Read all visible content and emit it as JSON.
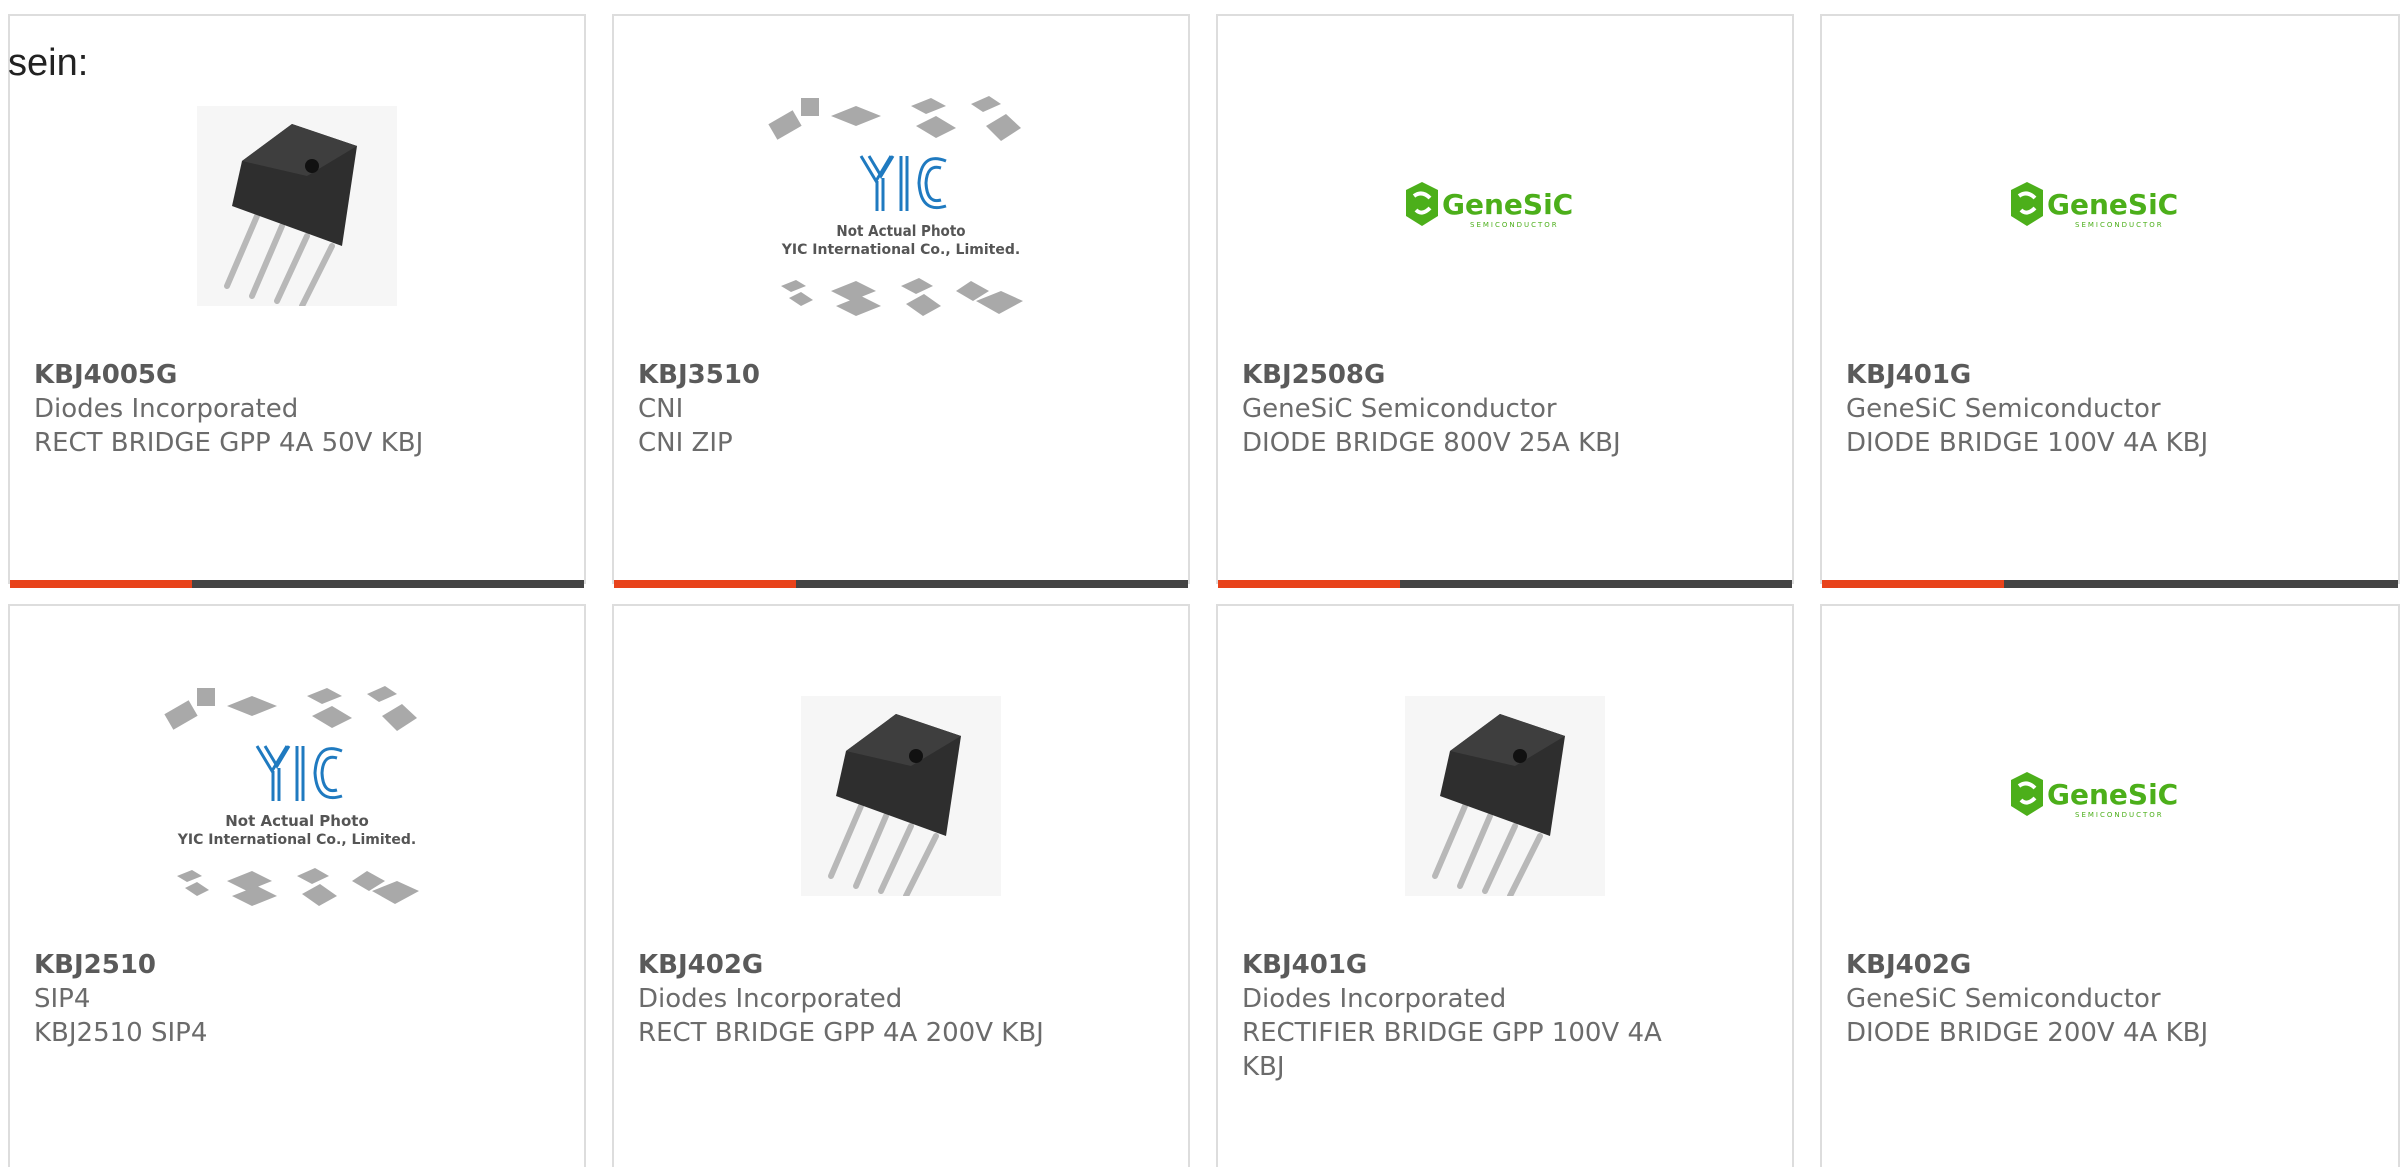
{
  "intro_text": "sein:",
  "colors": {
    "accent": "#e8431b",
    "bar_dark": "#444444",
    "genesic_green": "#4caf1a",
    "yic_blue": "#1f7ac0"
  },
  "cards": [
    {
      "part_number": "KBJ4005G",
      "manufacturer": "Diodes Incorporated",
      "description": "RECT BRIDGE GPP 4A 50V KBJ",
      "image": "rectifier-package"
    },
    {
      "part_number": "KBJ3510",
      "manufacturer": "CNI",
      "description": "CNI ZIP",
      "image": "yic-placeholder",
      "placeholder_line1": "Not Actual Photo",
      "placeholder_line2": "YIC International Co., Limited."
    },
    {
      "part_number": "KBJ2508G",
      "manufacturer": "GeneSiC Semiconductor",
      "description": "DIODE BRIDGE 800V 25A KBJ",
      "image": "genesic-logo",
      "logo_text": "GeneSiC",
      "logo_subtext": "SEMICONDUCTOR"
    },
    {
      "part_number": "KBJ401G",
      "manufacturer": "GeneSiC Semiconductor",
      "description": "DIODE BRIDGE 100V 4A KBJ",
      "image": "genesic-logo",
      "logo_text": "GeneSiC",
      "logo_subtext": "SEMICONDUCTOR"
    },
    {
      "part_number": "KBJ2510",
      "manufacturer": "SIP4",
      "description": "KBJ2510 SIP4",
      "image": "yic-placeholder",
      "placeholder_line1": "Not Actual Photo",
      "placeholder_line2": "YIC International Co., Limited."
    },
    {
      "part_number": "KBJ402G",
      "manufacturer": "Diodes Incorporated",
      "description": "RECT BRIDGE GPP 4A 200V KBJ",
      "image": "rectifier-package"
    },
    {
      "part_number": "KBJ401G",
      "manufacturer": "Diodes Incorporated",
      "description": "RECTIFIER BRIDGE GPP 100V 4A KBJ",
      "image": "rectifier-package"
    },
    {
      "part_number": "KBJ402G",
      "manufacturer": "GeneSiC Semiconductor",
      "description": "DIODE BRIDGE 200V 4A KBJ",
      "image": "genesic-logo",
      "logo_text": "GeneSiC",
      "logo_subtext": "SEMICONDUCTOR"
    }
  ]
}
